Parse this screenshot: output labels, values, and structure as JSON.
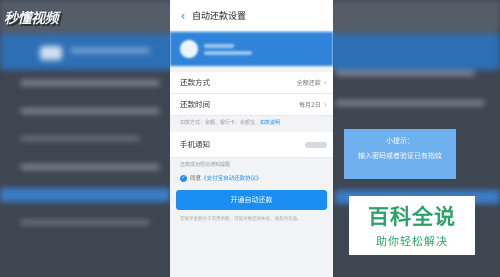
{
  "watermark": {
    "logo_text": "秒懂视频"
  },
  "screen": {
    "title": "自动还款设置",
    "back_icon": "chevron-left-icon",
    "account": {
      "name": "",
      "detail": ""
    },
    "settings": [
      {
        "label": "还款方式",
        "value": "全额还款"
      },
      {
        "label": "还款时间",
        "value": "每月2日"
      }
    ],
    "method_hint": {
      "text": "扣款方式：余额、银行卡、余额宝、",
      "link": "扣款说明"
    },
    "notify": {
      "label": "手机通知",
      "value": ""
    },
    "notify_desc": "还款成功短信通知提醒",
    "agreement": {
      "prefix": "同意",
      "link": "《支付宝自动还款协议》"
    },
    "primary_button": "开通自动还款",
    "footer_note": "若账单金额大于可用余额，可能导致还款失败，请及时充值。"
  },
  "tooltip": {
    "title": "小提示：",
    "body": "输入密码或者验证已有指纹"
  },
  "brand": {
    "main": "百科全说",
    "sub": "助你轻松解决"
  },
  "colors": {
    "accent": "#1a8ef2",
    "account_bar": "#2f83d9",
    "tooltip_bg": "#6fb0ef",
    "brand_green": "#2aa26a"
  }
}
